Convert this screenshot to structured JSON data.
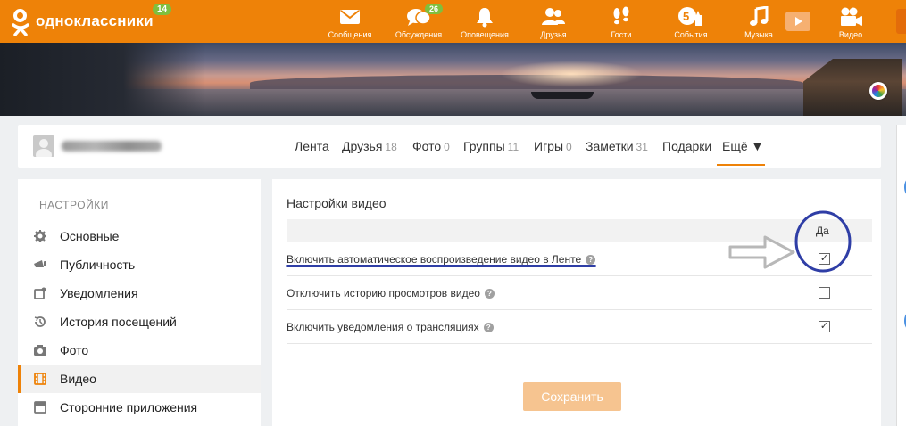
{
  "header": {
    "logo_text": "одноклассники",
    "logo_badge": "14",
    "nav": [
      {
        "label": "Сообщения",
        "icon": "envelope-icon",
        "badge": ""
      },
      {
        "label": "Обсуждения",
        "icon": "chat-bubbles-icon",
        "badge": "26"
      },
      {
        "label": "Оповещения",
        "icon": "bell-icon",
        "badge": ""
      },
      {
        "label": "Друзья",
        "icon": "friends-icon",
        "badge": ""
      },
      {
        "label": "Гости",
        "icon": "footprints-icon",
        "badge": ""
      },
      {
        "label": "События",
        "icon": "events-five-icon",
        "badge": ""
      },
      {
        "label": "Музыка",
        "icon": "music-note-icon",
        "badge": ""
      },
      {
        "label": "Видео",
        "icon": "video-camera-icon",
        "badge": ""
      }
    ]
  },
  "profile_tabs": [
    {
      "label": "Лента",
      "count": ""
    },
    {
      "label": "Друзья",
      "count": "18"
    },
    {
      "label": "Фото",
      "count": "0"
    },
    {
      "label": "Группы",
      "count": "11"
    },
    {
      "label": "Игры",
      "count": "0"
    },
    {
      "label": "Заметки",
      "count": "31"
    },
    {
      "label": "Подарки",
      "count": ""
    },
    {
      "label": "Ещё ▼",
      "count": ""
    }
  ],
  "sidebar": {
    "title": "НАСТРОЙКИ",
    "items": [
      {
        "label": "Основные",
        "icon": "gear-icon"
      },
      {
        "label": "Публичность",
        "icon": "megaphone-icon"
      },
      {
        "label": "Уведомления",
        "icon": "notification-icon"
      },
      {
        "label": "История посещений",
        "icon": "history-icon"
      },
      {
        "label": "Фото",
        "icon": "camera-icon"
      },
      {
        "label": "Видео",
        "icon": "film-icon"
      },
      {
        "label": "Сторонние приложения",
        "icon": "apps-icon"
      }
    ]
  },
  "main": {
    "title": "Настройки видео",
    "column_yes": "Да",
    "rows": [
      {
        "label": "Включить автоматическое воспроизведение видео в Ленте",
        "checked": "✓"
      },
      {
        "label": "Отключить историю просмотров видео",
        "checked": ""
      },
      {
        "label": "Включить уведомления о трансляциях",
        "checked": "✓"
      }
    ],
    "save_label": "Сохранить",
    "help_glyph": "?"
  },
  "colors": {
    "brand": "#ee8208",
    "badge": "#7fbf3e",
    "annotation": "#2f3ea6"
  }
}
